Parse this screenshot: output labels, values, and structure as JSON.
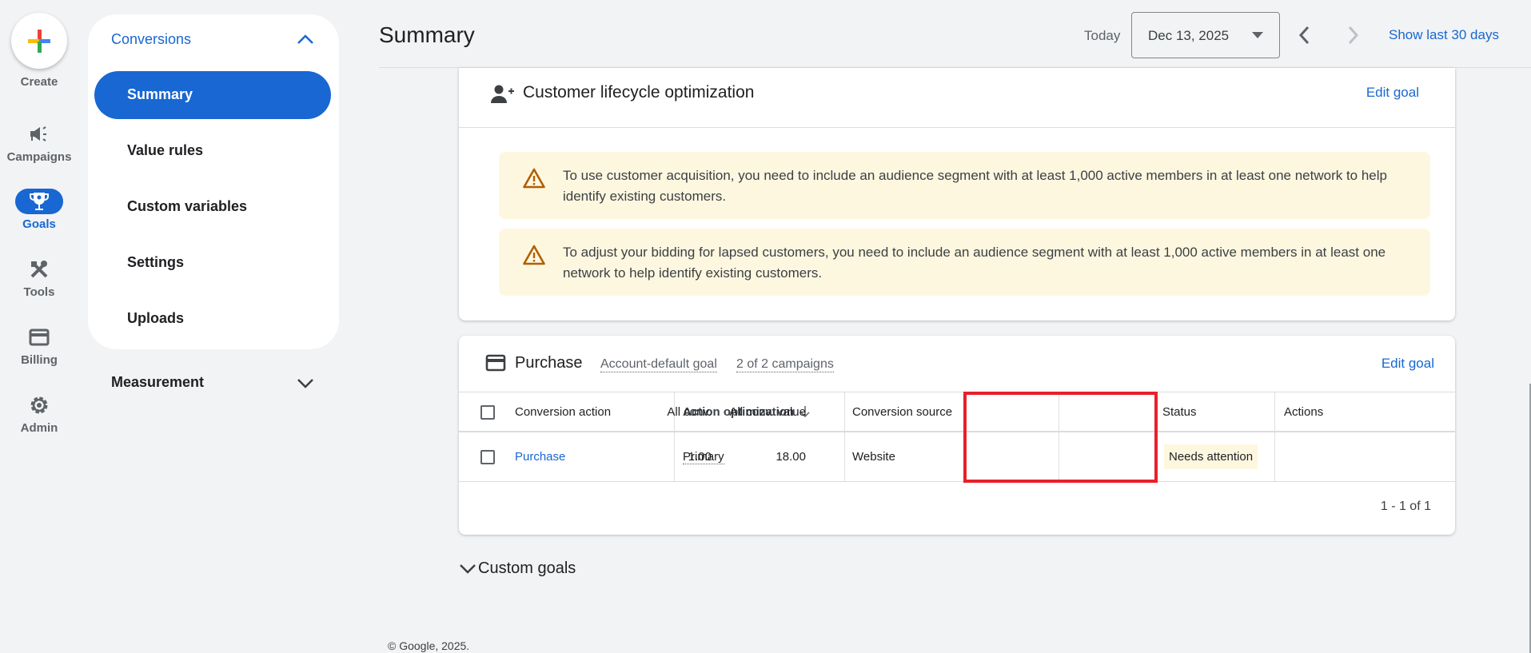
{
  "rail": {
    "create": "Create",
    "items": [
      {
        "label": "Campaigns"
      },
      {
        "label": "Goals"
      },
      {
        "label": "Tools"
      },
      {
        "label": "Billing"
      },
      {
        "label": "Admin"
      }
    ]
  },
  "sidenav": {
    "section": "Conversions",
    "items": [
      "Summary",
      "Value rules",
      "Custom variables",
      "Settings",
      "Uploads"
    ],
    "measurement": "Measurement"
  },
  "header": {
    "title": "Summary",
    "today": "Today",
    "date": "Dec 13, 2025",
    "show_last": "Show last 30 days"
  },
  "lifecycle": {
    "title": "Customer lifecycle optimization",
    "edit": "Edit goal",
    "warnings": [
      "To use customer acquisition, you need to include an audience segment with at least 1,000 active members in at least one network to help identify existing customers.",
      "To adjust your bidding for lapsed customers, you need to include an audience segment with at least 1,000 active members in at least one network to help identify existing customers."
    ]
  },
  "purchase": {
    "title": "Purchase",
    "default_goal": "Account-default goal",
    "campaigns": "2 of 2 campaigns",
    "edit": "Edit goal",
    "columns": [
      "Conversion action",
      "Action optimization",
      "Conversion source",
      "All conv.",
      "All conv. value",
      "Status",
      "Actions"
    ],
    "rows": [
      {
        "action": "Purchase",
        "optimization": "Primary",
        "source": "Website",
        "all_conv": "1.00",
        "all_conv_value": "18.00",
        "status": "Needs attention"
      }
    ],
    "pager": "1 - 1 of 1"
  },
  "custom_goals": "Custom goals",
  "footer": "© Google, 2025.",
  "colors": {
    "accent": "#1967d2",
    "warning_bg": "#fef7e0",
    "warning_icon": "#b06000",
    "highlight": "#e8202a"
  }
}
